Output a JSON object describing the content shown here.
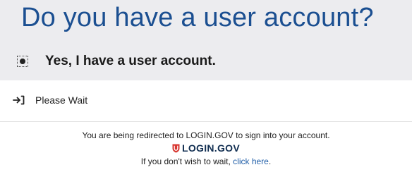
{
  "page": {
    "title": "Do you have a user account?"
  },
  "account_option": {
    "label": "Yes, I have a user account.",
    "selected": true
  },
  "status": {
    "icon": "arrow-into-bracket-icon",
    "label": "Please Wait"
  },
  "redirect": {
    "message": "You are being redirected to LOGIN.GOV to sign into your account.",
    "logo_text": "LOGIN.GOV",
    "logo_color": "#d83933",
    "wait_prefix": "If you don't wish to wait, ",
    "link_label": "click here",
    "wait_suffix": "."
  },
  "colors": {
    "title": "#1b4f91",
    "header_background": "#ececef",
    "link": "#1f5ea8"
  }
}
